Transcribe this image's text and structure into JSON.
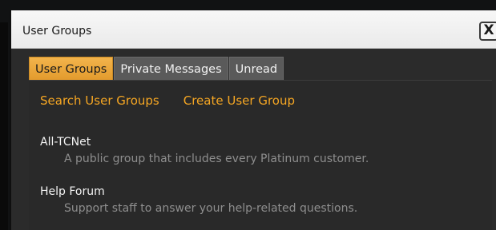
{
  "window": {
    "title": "User Groups",
    "close_label": "X"
  },
  "tabs": [
    {
      "label": "User Groups",
      "active": true
    },
    {
      "label": "Private Messages",
      "active": false
    },
    {
      "label": "Unread",
      "active": false
    }
  ],
  "actions": {
    "search_label": "Search User Groups",
    "create_label": "Create User Group"
  },
  "groups": [
    {
      "name": "All-TCNet",
      "description": "A public group that includes every Platinum customer."
    },
    {
      "name": "Help Forum",
      "description": "Support staff to answer your help-related questions."
    }
  ],
  "colors": {
    "accent": "#f5a623",
    "active_tab": "#e9a33a",
    "panel_bg": "#2a2a2a"
  }
}
